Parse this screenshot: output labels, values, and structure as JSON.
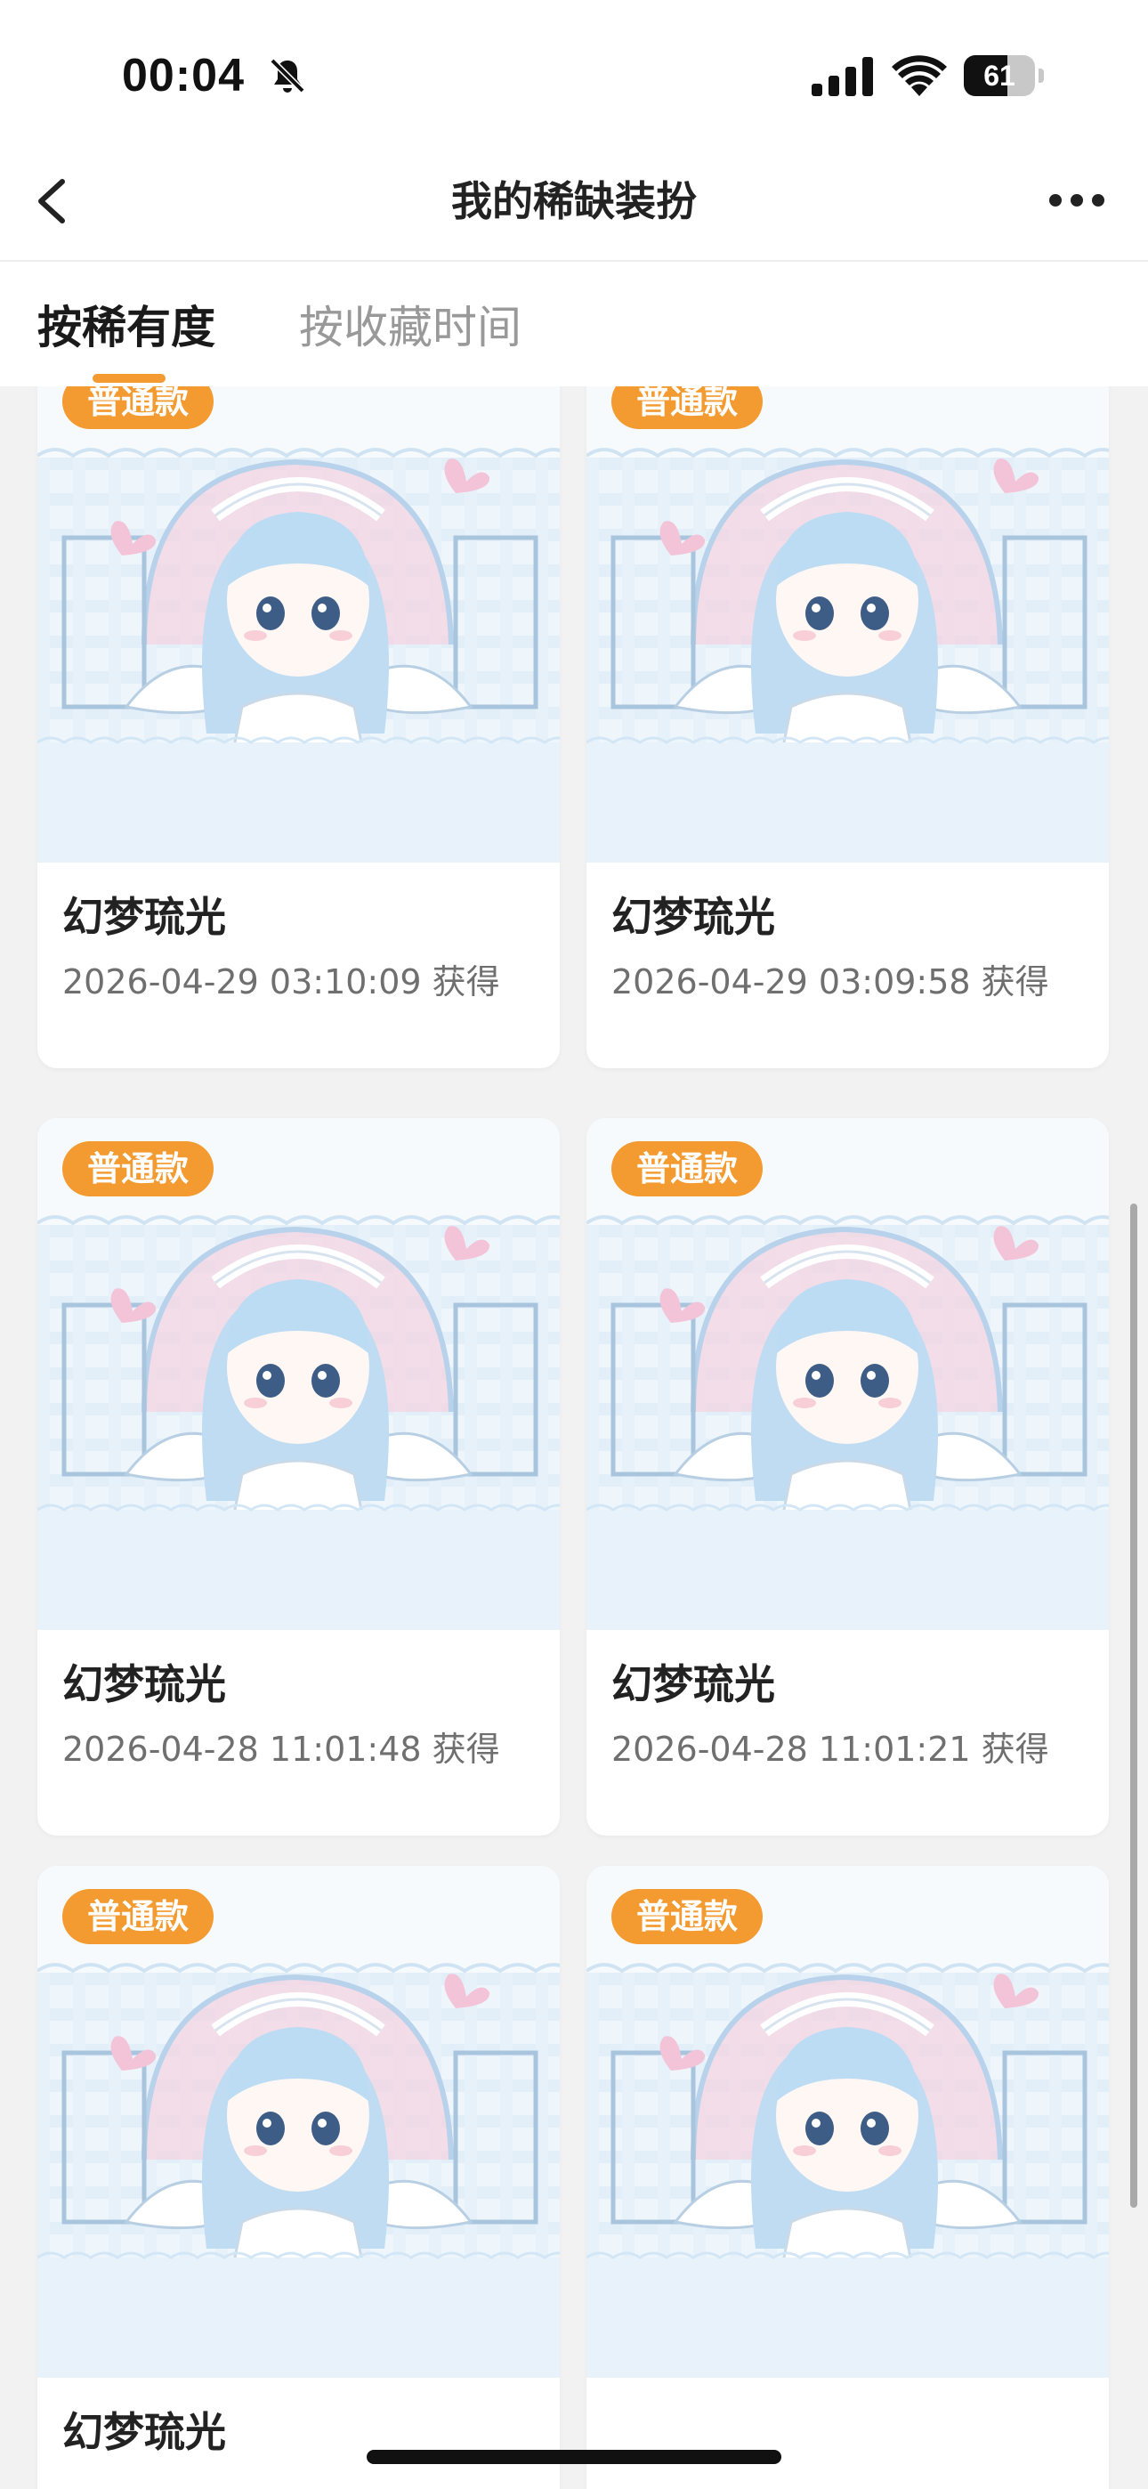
{
  "status_bar": {
    "time": "00:04",
    "battery": "61",
    "battery_level": 0.61
  },
  "nav": {
    "title": "我的稀缺装扮"
  },
  "tabs": [
    {
      "label": "按稀有度",
      "active": true
    },
    {
      "label": "按收藏时间",
      "active": false
    }
  ],
  "cards": [
    {
      "badge": "普通款",
      "title": "幻梦琉光",
      "date": "2026-04-29 03:10:09 获得"
    },
    {
      "badge": "普通款",
      "title": "幻梦琉光",
      "date": "2026-04-29 03:09:58 获得"
    },
    {
      "badge": "普通款",
      "title": "幻梦琉光",
      "date": "2026-04-28 11:01:48 获得"
    },
    {
      "badge": "普通款",
      "title": "幻梦琉光",
      "date": "2026-04-28 11:01:21 获得"
    },
    {
      "badge": "普通款",
      "title": "幻梦琉光",
      "date": ""
    },
    {
      "badge": "普通款",
      "title": "",
      "date": ""
    }
  ],
  "icons": {
    "muted": "bell-muted-icon",
    "signal": "signal-icon",
    "wifi": "wifi-icon",
    "back": "back-arrow-icon",
    "more": "more-dots-icon"
  },
  "colors": {
    "accent": "#f39a30",
    "background": "#f2f2f2",
    "card": "#ffffff"
  }
}
